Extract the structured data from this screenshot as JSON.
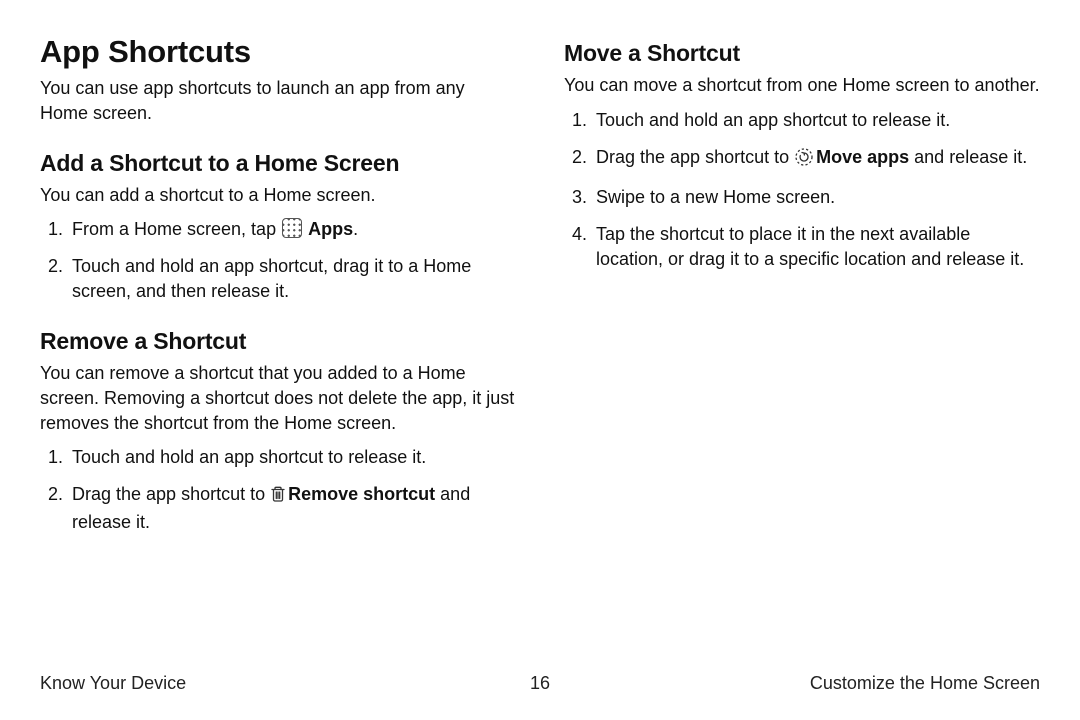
{
  "main": {
    "title": "App Shortcuts",
    "intro": "You can use app shortcuts to launch an app from any Home screen.",
    "add": {
      "heading": "Add a Shortcut to a Home Screen",
      "intro": "You can add a shortcut to a Home screen.",
      "step1_pre": "From a Home screen, tap ",
      "step1_label": "Apps",
      "step1_post": ".",
      "step2": "Touch and hold an app shortcut, drag it to a Home screen, and then release it."
    },
    "remove": {
      "heading": "Remove a Shortcut",
      "intro": "You can remove a shortcut that you added to a Home screen. Removing a shortcut does not delete the app, it just removes the shortcut from the Home screen.",
      "step1": "Touch and hold an app shortcut to release it.",
      "step2_pre": "Drag the app shortcut to ",
      "step2_label": "Remove shortcut",
      "step2_post": " and release it."
    },
    "move": {
      "heading": "Move a Shortcut",
      "intro": "You can move a shortcut from one Home screen to another.",
      "step1": "Touch and hold an app shortcut to release it.",
      "step2_pre": "Drag the app shortcut to ",
      "step2_label": "Move apps",
      "step2_post": " and release it.",
      "step3": "Swipe to a new Home screen.",
      "step4": "Tap the shortcut to place it in the next available location, or drag it to a specific location and release it."
    }
  },
  "footer": {
    "left": "Know Your Device",
    "page": "16",
    "right": "Customize the Home Screen"
  }
}
